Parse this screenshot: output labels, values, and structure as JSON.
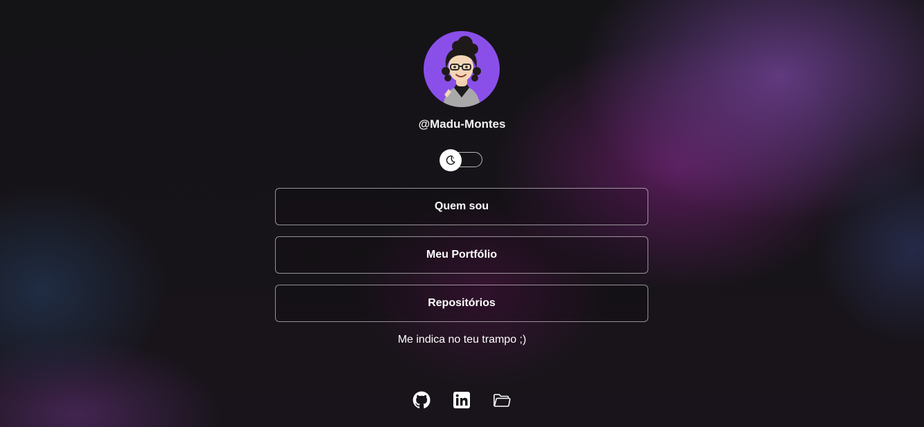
{
  "profile": {
    "username": "@Madu-Montes",
    "avatar_icon": "avatar-illustration",
    "avatar_bg": "#8a4fe8"
  },
  "theme_toggle": {
    "icon": "moon-icon"
  },
  "links": [
    {
      "label": "Quem sou"
    },
    {
      "label": "Meu Portfólio"
    },
    {
      "label": "Repositórios"
    }
  ],
  "tagline": "Me indica no teu trampo ;)",
  "social": [
    {
      "icon": "github-icon"
    },
    {
      "icon": "linkedin-icon"
    },
    {
      "icon": "folder-icon"
    }
  ]
}
